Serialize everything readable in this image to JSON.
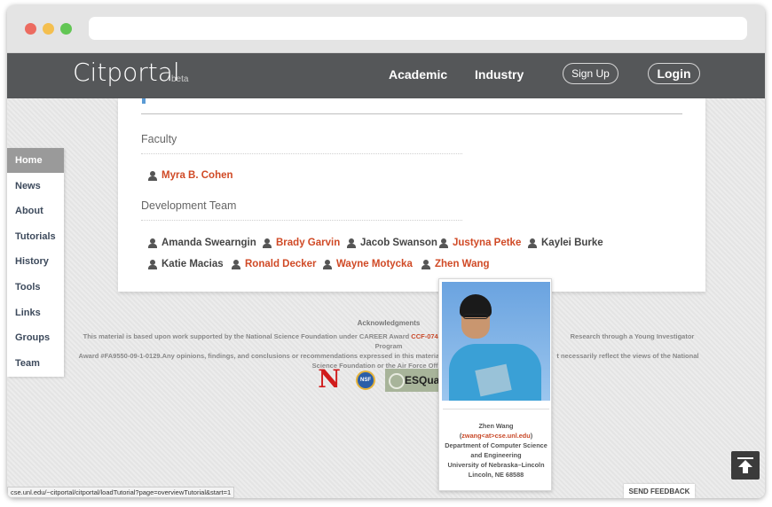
{
  "app": {
    "brand": "Citportal",
    "beta": "beta"
  },
  "nav": {
    "academic": "Academic",
    "industry": "Industry",
    "signup": "Sign Up",
    "login": "Login"
  },
  "sidebar": {
    "items": [
      "Home",
      "News",
      "About",
      "Tutorials",
      "History",
      "Tools",
      "Links",
      "Groups",
      "Team"
    ],
    "active": "Home"
  },
  "team": {
    "faculty_heading": "Faculty",
    "faculty": [
      {
        "name": "Myra B. Cohen",
        "linked": true
      }
    ],
    "dev_heading": "Development Team",
    "dev_row1": [
      {
        "name": "Amanda Swearngin",
        "linked": false
      },
      {
        "name": "Brady Garvin",
        "linked": true
      },
      {
        "name": "Jacob Swanson",
        "linked": false
      },
      {
        "name": "Justyna Petke",
        "linked": true
      },
      {
        "name": "Kaylei Burke",
        "linked": false
      }
    ],
    "dev_row2": [
      {
        "name": "Katie Macias",
        "linked": false
      },
      {
        "name": "Ronald Decker",
        "linked": true
      },
      {
        "name": "Wayne Motycka",
        "linked": true
      },
      {
        "name": "Zhen Wang",
        "linked": true
      }
    ]
  },
  "ack": {
    "title": "Acknowledgments",
    "line1_a": "This material is based upon work supported by the National Science Foundation under CAREER Award",
    "line1_award": "CCF-0747009",
    "line1_b": "Research through a Young Investigator Program",
    "line2_a": "Award #FA9550-09-1-0129.Any opinions, findings, and conclusions or recommendations expressed in this materia",
    "line2_b": "t necessarily reflect the views of the National",
    "line3": "Science Foundation or the Air Force Office of Sc"
  },
  "logos": {
    "unl": "N",
    "nsf": "NSF",
    "esquared": "ESQua"
  },
  "popup": {
    "name": "Zhen Wang",
    "email": "zwang<at>cse.unl.edu",
    "dept": "Department of Computer Science",
    "dept2": "and Engineering",
    "univ": "University of Nebraska–Lincoln",
    "city": "Lincoln, NE 68588"
  },
  "status_url": "cse.unl.edu/~citportal/citportal/loadTutorial?page=overviewTutorial&start=1",
  "feedback": "SEND FEEDBACK",
  "colors": {
    "nav": "#555759",
    "link": "#d04a26",
    "text": "#444444"
  }
}
